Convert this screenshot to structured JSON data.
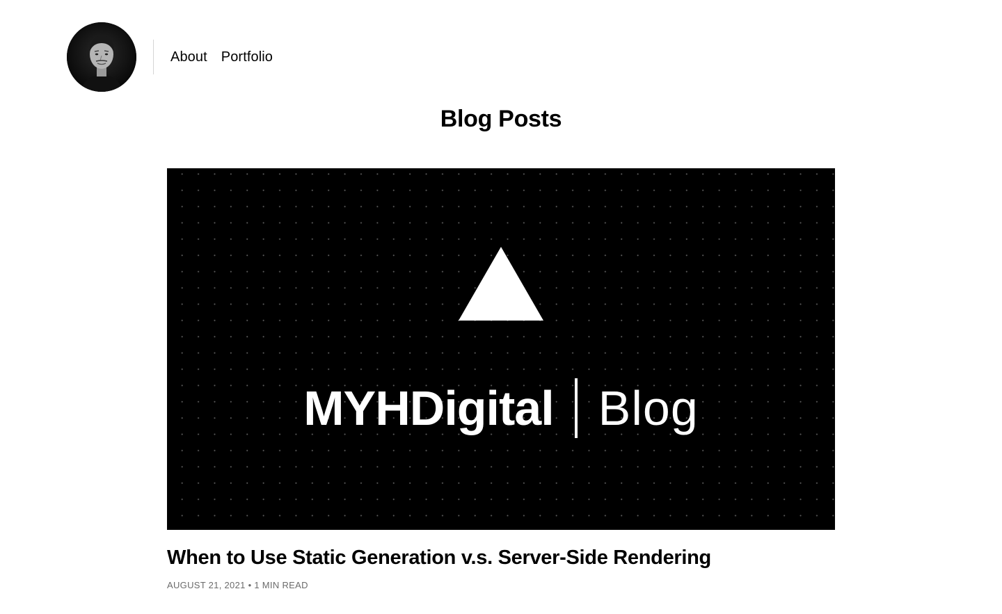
{
  "header": {
    "avatar_alt": "avatar",
    "nav": [
      {
        "label": "About"
      },
      {
        "label": "Portfolio"
      }
    ]
  },
  "main": {
    "page_title": "Blog Posts",
    "posts": [
      {
        "cover": {
          "brand": "MYHDigital",
          "separator": "|",
          "section": "Blog",
          "icon": "triangle-logo-icon",
          "background_color": "#000000",
          "dot_color": "#5a5a5a"
        },
        "title": "When to Use Static Generation v.s. Server-Side Rendering",
        "date": "AUGUST 21, 2021",
        "meta_separator": "•",
        "read_time": "1 MIN READ"
      }
    ]
  }
}
